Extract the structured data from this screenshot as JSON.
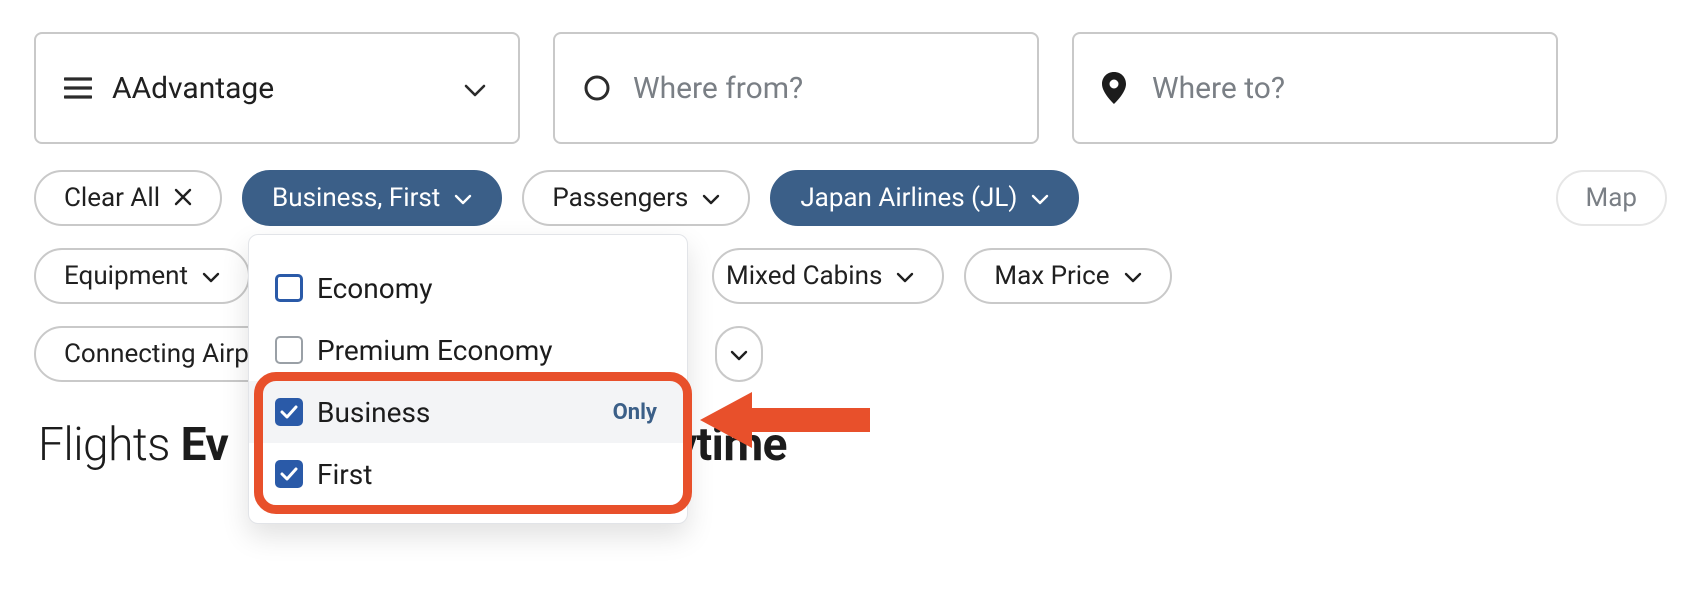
{
  "search": {
    "program_label": "AAdvantage",
    "from_placeholder": "Where from?",
    "to_placeholder": "Where to?"
  },
  "filters": {
    "clear_all": "Clear All",
    "cabin_label": "Business, First",
    "passengers": "Passengers",
    "airline": "Japan Airlines (JL)",
    "map": "Map",
    "equipment": "Equipment",
    "mixed_cabins": "Mixed Cabins",
    "max_price": "Max Price",
    "connecting": "Connecting Airp"
  },
  "cabin_dropdown": {
    "options": [
      {
        "label": "Economy",
        "checked": false,
        "focused": true
      },
      {
        "label": "Premium Economy",
        "checked": false,
        "focused": false
      },
      {
        "label": "Business",
        "checked": true,
        "focused": false,
        "only_visible": true
      },
      {
        "label": "First",
        "checked": true,
        "focused": false
      }
    ],
    "only_label": "Only"
  },
  "headline": {
    "prefix": "Flights ",
    "bold1": "Ev",
    "mid": " ",
    "bold2": "Anytime"
  }
}
